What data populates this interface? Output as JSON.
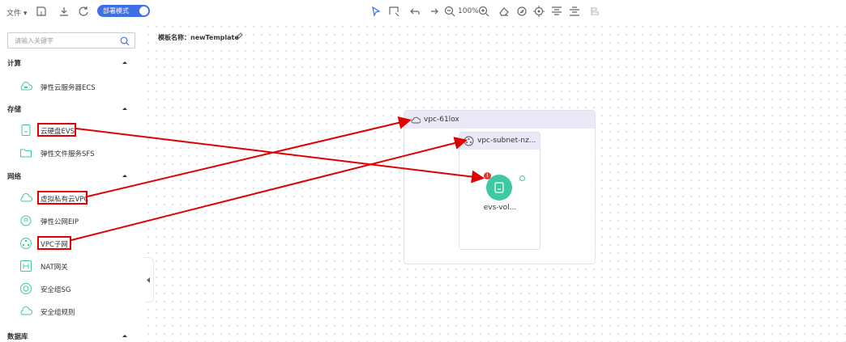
{
  "toolbar": {
    "file_menu": "文件",
    "mode_toggle": "部署模式",
    "zoom": "100%",
    "icons": [
      "save-icon",
      "download-icon",
      "refresh-icon",
      "select-icon",
      "box-select-icon",
      "undo-icon",
      "redo-icon",
      "zoom-out-icon",
      "zoom-in-icon",
      "eraser-icon",
      "compass-icon",
      "target-icon",
      "align-top-icon",
      "align-bottom-icon",
      "layout-icon"
    ]
  },
  "sidebar": {
    "search_placeholder": "请输入关键字",
    "categories": [
      {
        "label": "计算",
        "items": [
          {
            "label": "弹性云服务器ECS",
            "icon": "ecs-icon"
          }
        ]
      },
      {
        "label": "存储",
        "items": [
          {
            "label": "云硬盘EVS",
            "icon": "evs-icon"
          },
          {
            "label": "弹性文件服务SFS",
            "icon": "folder-icon"
          }
        ]
      },
      {
        "label": "网络",
        "items": [
          {
            "label": "虚拟私有云VPC",
            "icon": "cloud-icon"
          },
          {
            "label": "弹性公网EIP",
            "icon": "eip-icon"
          },
          {
            "label": "VPC子网",
            "icon": "subnet-icon"
          },
          {
            "label": "NAT网关",
            "icon": "nat-icon"
          },
          {
            "label": "安全组SG",
            "icon": "security-group-icon"
          },
          {
            "label": "安全组规则",
            "icon": "rule-icon"
          }
        ]
      },
      {
        "label": "数据库",
        "items": []
      }
    ]
  },
  "canvas": {
    "template_name": "模板名称：newTemplate",
    "vpc_label": "vpc-61lox",
    "subnet_label": "vpc-subnet-nz...",
    "evs_label": "evs-vol...",
    "evs_badge": "!"
  },
  "colors": {
    "accent": "#3f6fe6",
    "node": "#3ec9a0",
    "highlight": "#e00000",
    "group_header": "#ebe8f8"
  }
}
